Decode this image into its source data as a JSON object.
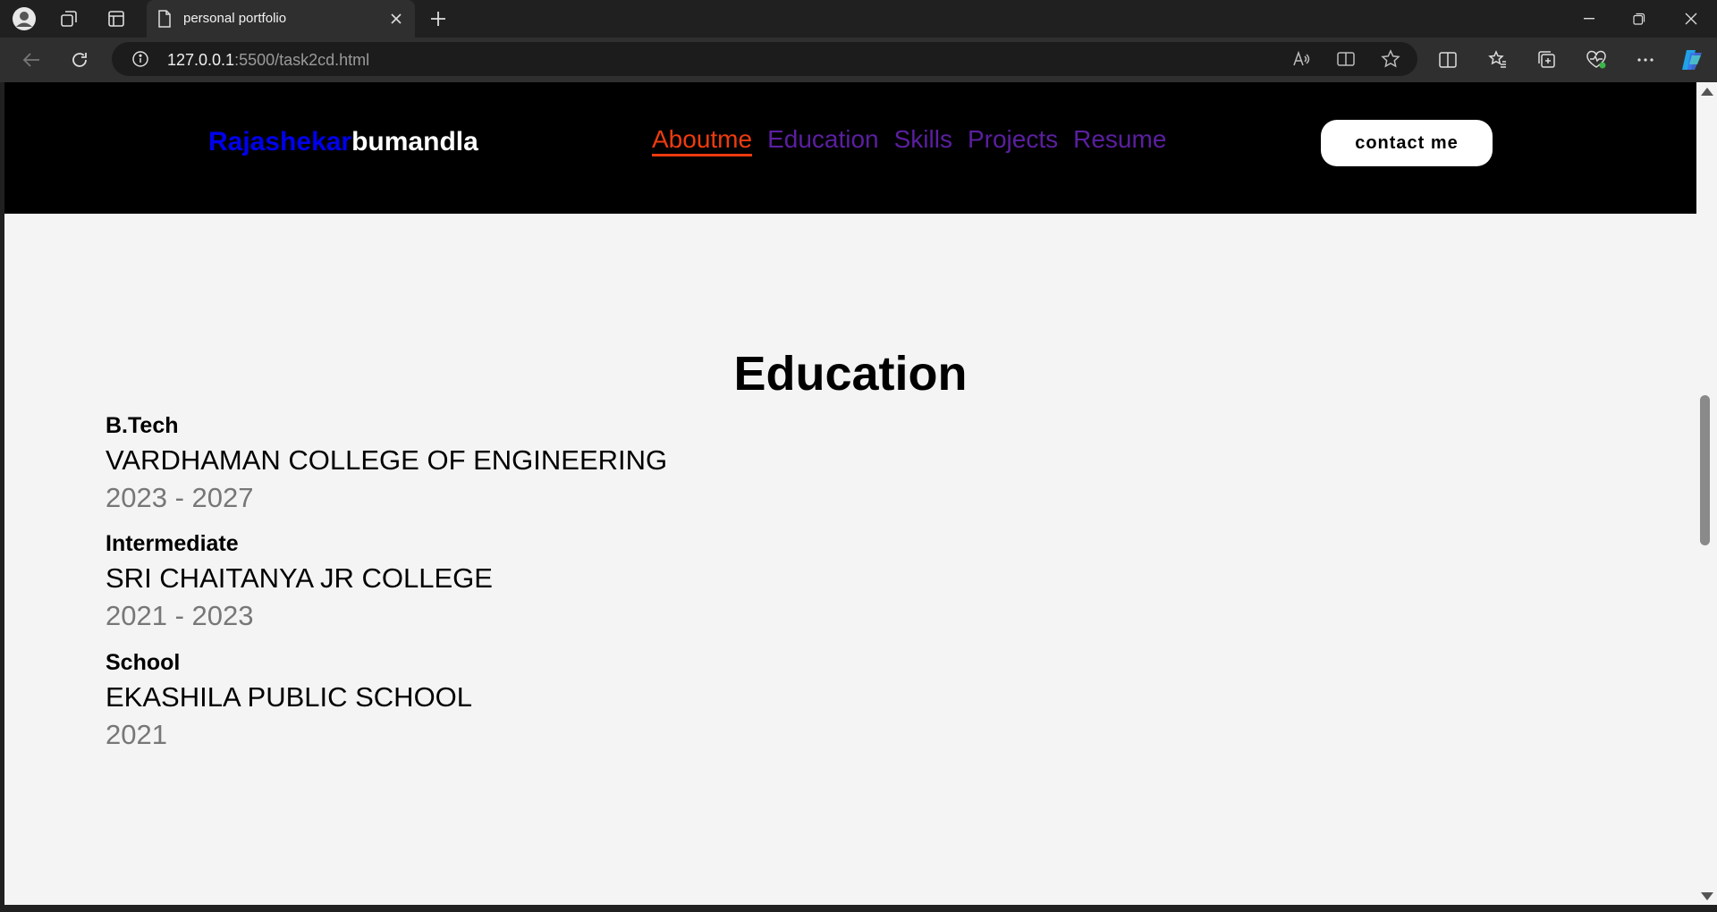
{
  "browser": {
    "tab_title": "personal portfolio",
    "url_host": "127.0.0.1",
    "url_rest": ":5500/task2cd.html"
  },
  "site": {
    "logo_first": "Rajashekar",
    "logo_last": "bumandla",
    "nav": [
      {
        "label": "Aboutme"
      },
      {
        "label": "Education"
      },
      {
        "label": "Skills"
      },
      {
        "label": "Projects"
      },
      {
        "label": "Resume"
      }
    ],
    "contact_label": "contact me"
  },
  "education": {
    "title": "Education",
    "items": [
      {
        "degree": "B.Tech",
        "institution": "VARDHAMAN COLLEGE OF ENGINEERING",
        "years": "2023 - 2027"
      },
      {
        "degree": "Intermediate",
        "institution": "SRI CHAITANYA JR COLLEGE",
        "years": "2021 - 2023"
      },
      {
        "degree": "School",
        "institution": "EKASHILA PUBLIC SCHOOL",
        "years": "2021"
      }
    ]
  },
  "colors": {
    "logo_first": "#0000ee",
    "nav_link": "#5b1fa0",
    "nav_active": "#ee3b0e",
    "years_text": "#777777"
  }
}
